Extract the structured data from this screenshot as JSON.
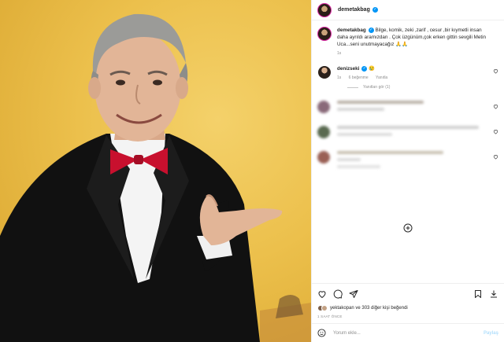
{
  "post": {
    "author": "demetakbag",
    "caption": "Bilge, komik, zeki ,zarif , cesur ,bir kıymetli insan daha ayrıldı aramızdan . Çok üzgünüm,çok erken gittin sevgili Metin Uca...seni unutmayacağız 🙏🙏",
    "caption_time": "1s"
  },
  "comments": [
    {
      "author": "denizseki",
      "text": "😢",
      "time": "1s",
      "likes": "6 beğenme",
      "reply": "Yanıtla",
      "see_replies": "Yanıtları gör (1)"
    }
  ],
  "footer": {
    "likes_text": "yektakopan ve 303 diğer kişi beğendi",
    "time_ago": "1 SAAT ÖNCE",
    "comment_placeholder": "Yorum ekle...",
    "post_button": "Paylaş"
  },
  "colors": {
    "verified": "#0095f6",
    "photo_bg": "#ecc04c",
    "bow_tie": "#c8102e"
  },
  "icons": [
    "heart-icon",
    "comment-icon",
    "share-icon",
    "bookmark-icon",
    "download-icon",
    "emoji-icon",
    "plus-circle-icon"
  ]
}
